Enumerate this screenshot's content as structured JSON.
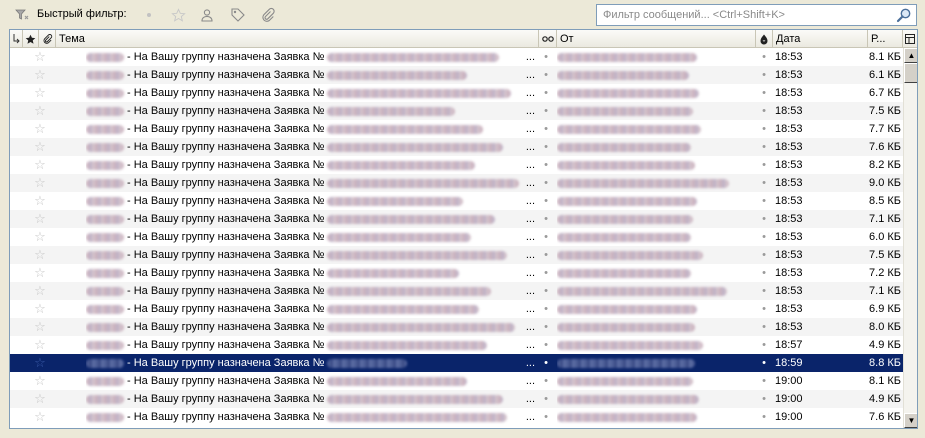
{
  "filter_bar": {
    "label": "Быстрый фильтр:",
    "search_placeholder": "Фильтр сообщений... <Ctrl+Shift+K>"
  },
  "columns": {
    "thread": "thread-icon",
    "starred": "star-icon",
    "attachment": "paperclip-icon",
    "subject": "Тема",
    "read": "read-icon",
    "from": "От",
    "junk": "junk-icon",
    "date": "Дата",
    "size": "Р...",
    "picker": "column-picker-icon"
  },
  "messages": [
    {
      "subject": "- На Вашу группу назначена Заявка №",
      "time": "18:53",
      "size": "8.1 КБ",
      "selected": false
    },
    {
      "subject": "- На Вашу группу назначена Заявка №",
      "time": "18:53",
      "size": "6.1 КБ",
      "selected": false
    },
    {
      "subject": "- На Вашу группу назначена Заявка №",
      "time": "18:53",
      "size": "6.7 КБ",
      "selected": false
    },
    {
      "subject": "- На Вашу группу назначена Заявка №",
      "time": "18:53",
      "size": "7.5 КБ",
      "selected": false
    },
    {
      "subject": "- На Вашу группу назначена Заявка №",
      "time": "18:53",
      "size": "7.7 КБ",
      "selected": false
    },
    {
      "subject": "- На Вашу группу назначена Заявка №",
      "time": "18:53",
      "size": "7.6 КБ",
      "selected": false
    },
    {
      "subject": "- На Вашу группу назначена Заявка №",
      "time": "18:53",
      "size": "8.2 КБ",
      "selected": false
    },
    {
      "subject": "- На Вашу группу назначена Заявка №",
      "time": "18:53",
      "size": "9.0 КБ",
      "selected": false
    },
    {
      "subject": "- На Вашу группу назначена Заявка №",
      "time": "18:53",
      "size": "8.5 КБ",
      "selected": false
    },
    {
      "subject": "- На Вашу группу назначена Заявка №",
      "time": "18:53",
      "size": "7.1 КБ",
      "selected": false
    },
    {
      "subject": "- На Вашу группу назначена Заявка №",
      "time": "18:53",
      "size": "6.0 КБ",
      "selected": false
    },
    {
      "subject": "- На Вашу группу назначена Заявка №",
      "time": "18:53",
      "size": "7.5 КБ",
      "selected": false
    },
    {
      "subject": "- На Вашу группу назначена Заявка №",
      "time": "18:53",
      "size": "7.2 КБ",
      "selected": false
    },
    {
      "subject": "- На Вашу группу назначена Заявка №",
      "time": "18:53",
      "size": "7.1 КБ",
      "selected": false
    },
    {
      "subject": "- На Вашу группу назначена Заявка №",
      "time": "18:53",
      "size": "6.9 КБ",
      "selected": false
    },
    {
      "subject": "- На Вашу группу назначена Заявка №",
      "time": "18:53",
      "size": "8.0 КБ",
      "selected": false
    },
    {
      "subject": "- На Вашу группу назначена Заявка №",
      "time": "18:57",
      "size": "4.9 КБ",
      "selected": false
    },
    {
      "subject": "- На Вашу группу назначена Заявка №",
      "time": "18:59",
      "size": "8.8 КБ",
      "selected": true
    },
    {
      "subject": "- На Вашу группу назначена Заявка №",
      "time": "19:00",
      "size": "8.1 КБ",
      "selected": false
    },
    {
      "subject": "- На Вашу группу назначена Заявка №",
      "time": "19:00",
      "size": "4.9 КБ",
      "selected": false
    },
    {
      "subject": "- На Вашу группу назначена Заявка №",
      "time": "19:00",
      "size": "7.6 КБ",
      "selected": false
    }
  ],
  "colors": {
    "selection": "#0a246a",
    "chrome": "#ece9d8"
  }
}
